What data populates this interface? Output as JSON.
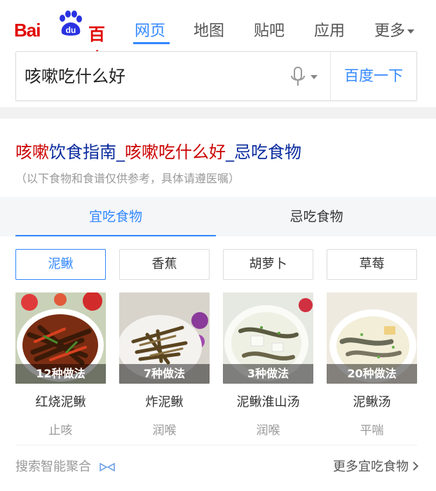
{
  "header": {
    "logo_latin": "Bai",
    "logo_du": "du",
    "logo_cn": "百度",
    "nav": [
      {
        "label": "网页",
        "active": true
      },
      {
        "label": "地图",
        "active": false
      },
      {
        "label": "贴吧",
        "active": false
      },
      {
        "label": "应用",
        "active": false
      },
      {
        "label": "更多",
        "active": false
      }
    ]
  },
  "search": {
    "query": "咳嗽吃什么好",
    "button_label": "百度一下"
  },
  "result": {
    "title_parts": [
      {
        "text": "咳嗽",
        "style": "red"
      },
      {
        "text": "饮食指南_",
        "style": "blue"
      },
      {
        "text": "咳嗽吃什么好",
        "style": "red"
      },
      {
        "text": "_忌吃食物",
        "style": "blue"
      }
    ],
    "subtitle": "（以下食物和食谱仅供参考，具体请遵医嘱）",
    "tabs": [
      {
        "label": "宜吃食物",
        "active": true
      },
      {
        "label": "忌吃食物",
        "active": false
      }
    ],
    "chips": [
      {
        "label": "泥鳅",
        "active": true
      },
      {
        "label": "香蕉",
        "active": false
      },
      {
        "label": "胡萝卜",
        "active": false
      },
      {
        "label": "草莓",
        "active": false
      }
    ],
    "foods": [
      {
        "caption": "12种做法",
        "name": "红烧泥鳅",
        "effect": "止咳"
      },
      {
        "caption": "7种做法",
        "name": "炸泥鳅",
        "effect": "润喉"
      },
      {
        "caption": "3种做法",
        "name": "泥鳅淮山汤",
        "effect": "润喉"
      },
      {
        "caption": "20种做法",
        "name": "泥鳅汤",
        "effect": "平喘"
      }
    ],
    "footer_left": "搜索智能聚合",
    "footer_right": "更多宜吃食物"
  },
  "colors": {
    "accent": "#3388ff",
    "brand_red": "#e10601",
    "title_red": "#cc0000",
    "title_blue": "#0a2b9e"
  }
}
